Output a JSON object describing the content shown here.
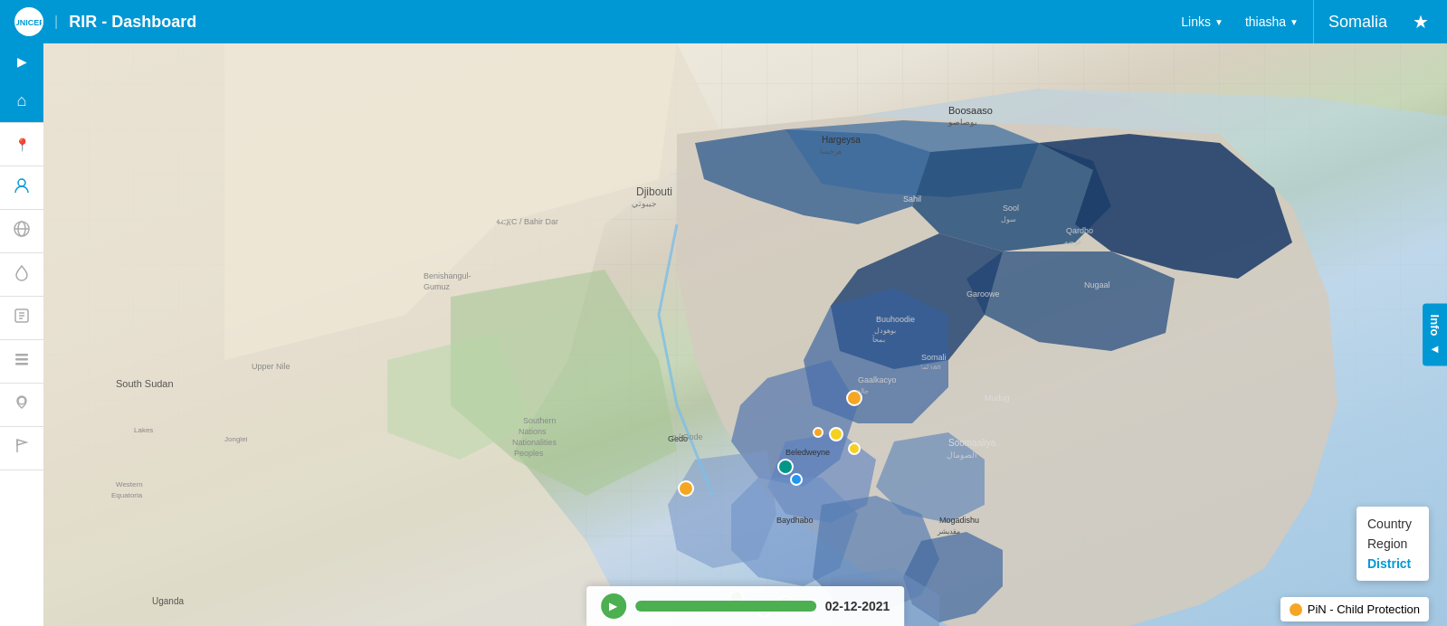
{
  "navbar": {
    "brand": {
      "logo_text": "U",
      "title": "RIR - Dashboard"
    },
    "links_label": "Links",
    "user_label": "thiasha",
    "country_label": "Somalia",
    "star_label": "★"
  },
  "sidebar": {
    "toggle_arrow": "▶",
    "items": [
      {
        "id": "home",
        "icon": "⌂",
        "active": true
      },
      {
        "id": "pin",
        "icon": "📍",
        "active": false
      },
      {
        "id": "child",
        "icon": "👤",
        "active": false
      },
      {
        "id": "globe",
        "icon": "🌐",
        "active": false
      },
      {
        "id": "water",
        "icon": "💧",
        "active": false
      },
      {
        "id": "book",
        "icon": "📖",
        "active": false
      },
      {
        "id": "list",
        "icon": "☰",
        "active": false
      },
      {
        "id": "location",
        "icon": "📌",
        "active": false
      },
      {
        "id": "flag",
        "icon": "🚩",
        "active": false
      }
    ]
  },
  "info_panel": {
    "label": "Info",
    "arrow": "◄"
  },
  "level_selector": {
    "levels": [
      {
        "id": "country",
        "label": "Country",
        "active": false
      },
      {
        "id": "region",
        "label": "Region",
        "active": false
      },
      {
        "id": "district",
        "label": "District",
        "active": true
      }
    ]
  },
  "legend": {
    "item_label": "PiN - Child Protection",
    "dot_color": "#f5a623"
  },
  "timeline": {
    "play_icon": "▶",
    "date": "02-12-2021",
    "progress": 10
  },
  "map": {
    "title": "Somalia Map"
  }
}
